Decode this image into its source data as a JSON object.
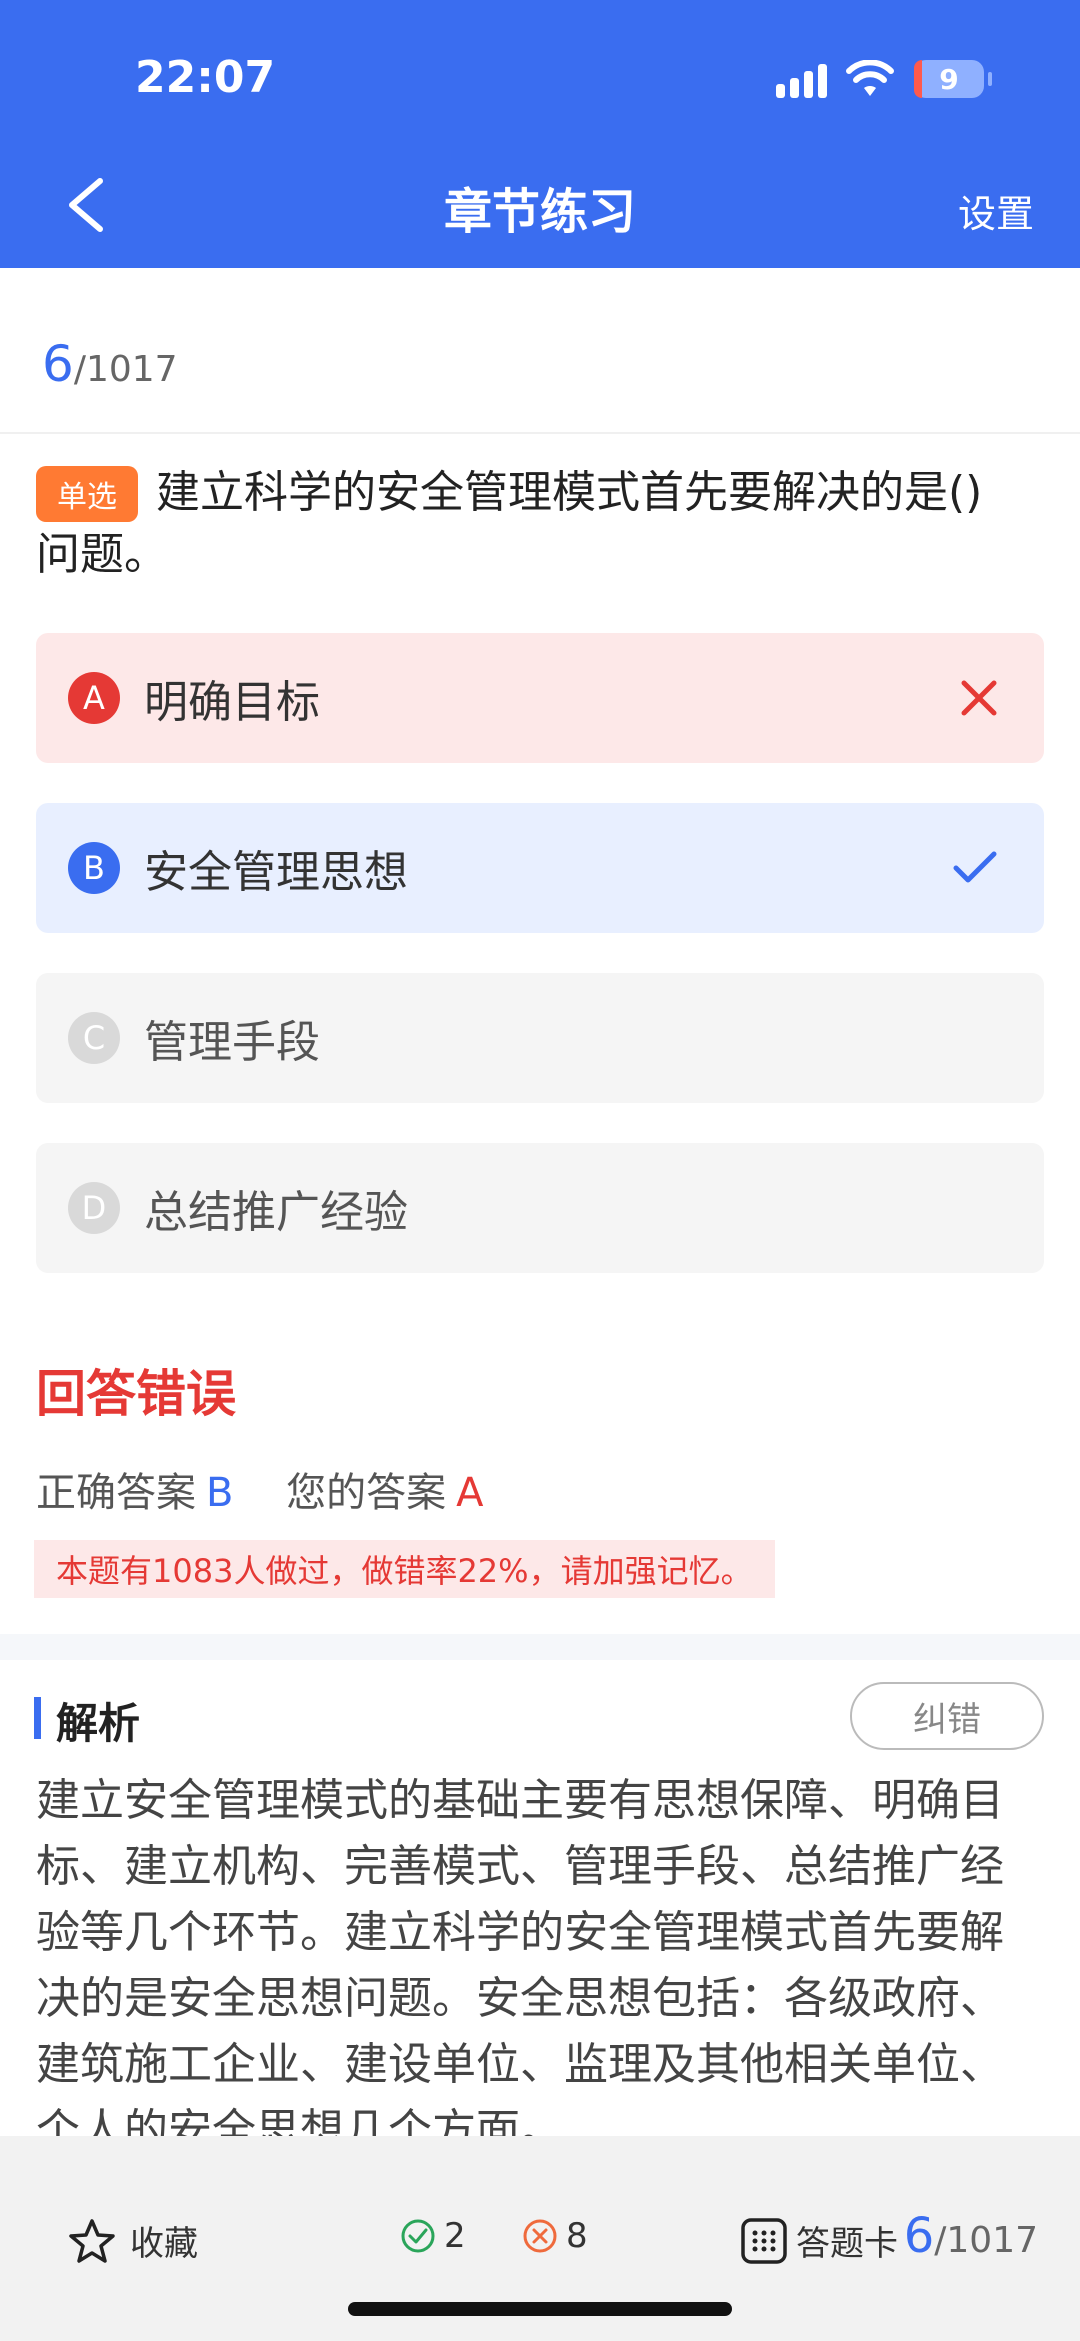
{
  "status": {
    "time": "22:07",
    "battery": "9"
  },
  "nav": {
    "title": "章节练习",
    "settings": "设置"
  },
  "progress": {
    "current": "6",
    "total": "/1017"
  },
  "question": {
    "type": "单选",
    "text": "建立科学的安全管理模式首先要解决的是()问题。",
    "options": [
      {
        "letter": "A",
        "label": "明确目标",
        "state": "wrong"
      },
      {
        "letter": "B",
        "label": "安全管理思想",
        "state": "right"
      },
      {
        "letter": "C",
        "label": "管理手段",
        "state": "plain"
      },
      {
        "letter": "D",
        "label": "总结推广经验",
        "state": "plain"
      }
    ]
  },
  "result": {
    "title": "回答错误",
    "correct_label": "正确答案",
    "correct": "B",
    "mine_label": "您的答案",
    "mine": "A",
    "stat": "本题有1083人做过，做错率22%，请加强记忆。"
  },
  "analysis": {
    "title": "解析",
    "report": "纠错",
    "text": "建立安全管理模式的基础主要有思想保障、明确目标、建立机构、完善模式、管理手段、总结推广经验等几个环节。建立科学的安全管理模式首先要解决的是安全思想问题。安全思想包括：各级政府、建筑施工企业、建设单位、监理及其他相关单位、个人的安全思想几个方面。"
  },
  "bottom": {
    "favorite": "收藏",
    "correct_count": "2",
    "wrong_count": "8",
    "answer_card": "答题卡",
    "current": "6",
    "total": "/1017"
  },
  "colors": {
    "primary": "#3a6df0",
    "error": "#e53935",
    "tag": "#ff7a33"
  }
}
